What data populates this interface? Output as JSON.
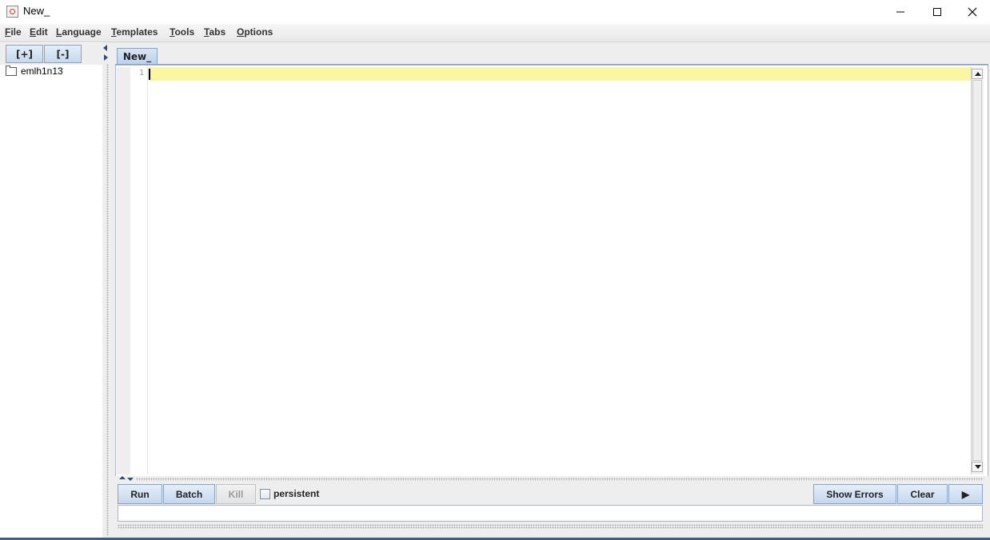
{
  "window": {
    "title": "New_"
  },
  "menu": {
    "items": [
      {
        "label": "File",
        "mnemonic": "F",
        "rest": "ile"
      },
      {
        "label": "Edit",
        "mnemonic": "E",
        "rest": "dit"
      },
      {
        "label": "Language",
        "mnemonic": "L",
        "rest": "anguage"
      },
      {
        "label": "Templates",
        "mnemonic": "T",
        "rest": "emplates"
      },
      {
        "label": "Tools",
        "mnemonic": "T",
        "rest": "ools"
      },
      {
        "label": "Tabs",
        "mnemonic": "T",
        "rest": "abs"
      },
      {
        "label": "Options",
        "mnemonic": "O",
        "rest": "ptions"
      }
    ]
  },
  "left_panel": {
    "expand_label": "[+]",
    "collapse_label": "[-]",
    "tree_items": [
      "emlh1n13"
    ]
  },
  "editor": {
    "tab_label": "New_",
    "line_number": "1"
  },
  "toolbar": {
    "run_label": "Run",
    "batch_label": "Batch",
    "kill_label": "Kill",
    "persistent_label": "persistent",
    "persistent_checked": false,
    "show_errors_label": "Show Errors",
    "clear_label": "Clear",
    "more_label": "▶"
  },
  "icons": {
    "window_controls": [
      "minimize-icon",
      "maximize-icon",
      "close-icon"
    ],
    "app_icon": "java-icon",
    "tree_icon": "folder-icon"
  },
  "colors": {
    "current_line_highlight": "#fbf6a2",
    "button_gradient_top": "#e4eef9",
    "button_gradient_bottom": "#c6d8ee",
    "accent": "#3f5f86"
  }
}
